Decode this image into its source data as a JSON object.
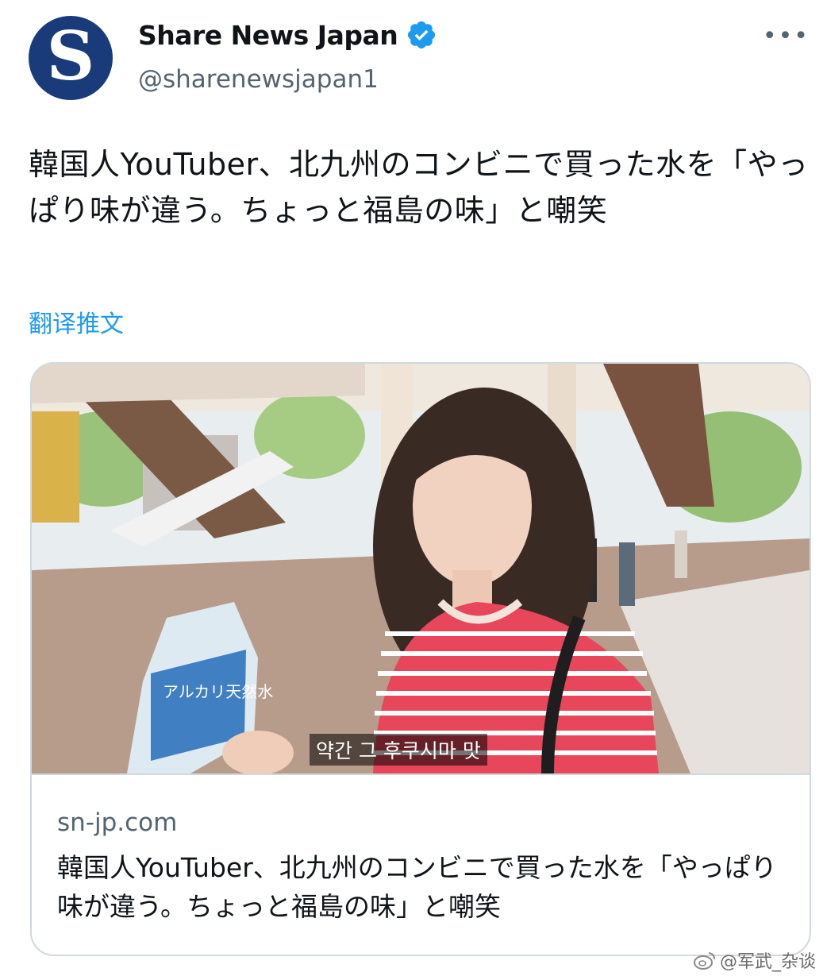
{
  "header": {
    "avatar_letter": "S",
    "display_name": "Share News Japan",
    "handle": "@sharenewsjapan1",
    "verified_icon": "verified-badge-icon",
    "more_icon": "more-icon",
    "more_label": "•••"
  },
  "tweet": {
    "text": "韓国人YouTuber、北九州のコンビニで買った水を「やっぱり味が違う。ちょっと福島の味」と嘲笑",
    "translate_label": "翻译推文"
  },
  "card": {
    "subtitle_caption": "약간 그 후쿠시마 맛",
    "bottle_label": "アルカリ天然水",
    "domain": "sn-jp.com",
    "title": "韓国人YouTuber、北九州のコンビニで買った水を「やっぱり味が違う。ちょっと福島の味」と嘲笑"
  },
  "watermark": {
    "text": "@军武_杂谈",
    "icon": "weibo-icon"
  },
  "colors": {
    "accent": "#1d9bf0",
    "avatar_bg": "#1a3b7a",
    "text_primary": "#0f1419",
    "text_secondary": "#536471",
    "border": "#cfd9de"
  }
}
